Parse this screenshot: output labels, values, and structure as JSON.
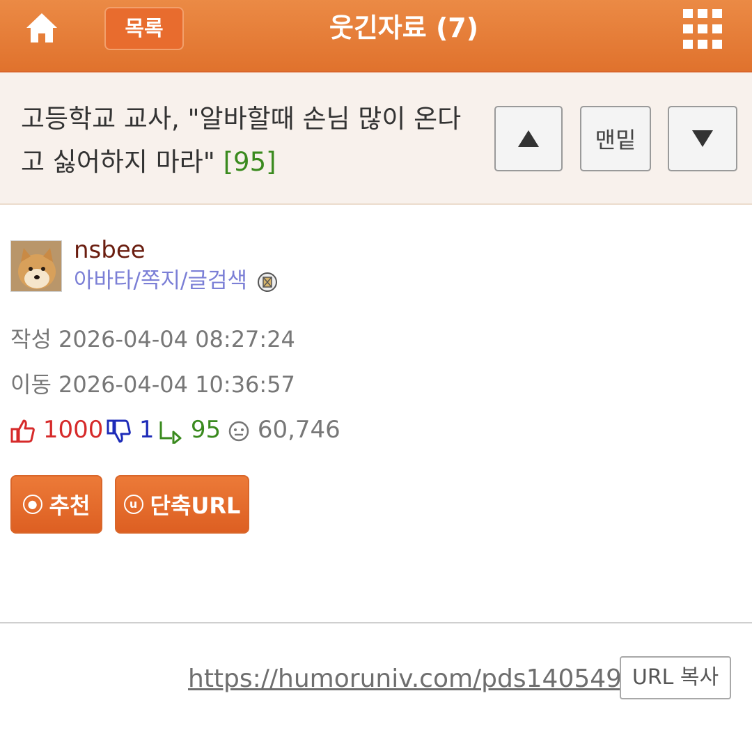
{
  "header": {
    "list_label": "목록",
    "title": "웃긴자료 (7)"
  },
  "post": {
    "title": "고등학교 교사, \"알바할때 손님 많이 온다고 싫어하지 마라\"",
    "comment_count": "[95]"
  },
  "nav": {
    "bottom_label": "맨밑"
  },
  "author": {
    "name": "nsbee",
    "links": "아바타/쪽지/글검색"
  },
  "meta": {
    "written": "작성 2026-04-04 08:27:24",
    "moved": "이동 2026-04-04 10:36:57"
  },
  "stats": {
    "up": "1000",
    "down": "1",
    "replies": "95",
    "views": "60,746"
  },
  "actions": {
    "recommend_icon": "ⓞ",
    "recommend": "추천",
    "shorturl_icon": "u",
    "shorturl": "단축URL"
  },
  "footer": {
    "url": "https://humoruniv.com/pds1405491",
    "copy_label": "URL 복사"
  },
  "colors": {
    "header_orange": "#e0722d",
    "comment_green": "#3a8a1e",
    "author_link": "#7b7fd6",
    "up_red": "#d62a2a",
    "down_blue": "#1d2bb8"
  },
  "icons": [
    "home-icon",
    "grid-menu-icon",
    "arrow-up-icon",
    "arrow-down-icon",
    "thumbs-up-icon",
    "thumbs-down-icon",
    "reply-icon",
    "views-face-icon",
    "badge-icon"
  ]
}
